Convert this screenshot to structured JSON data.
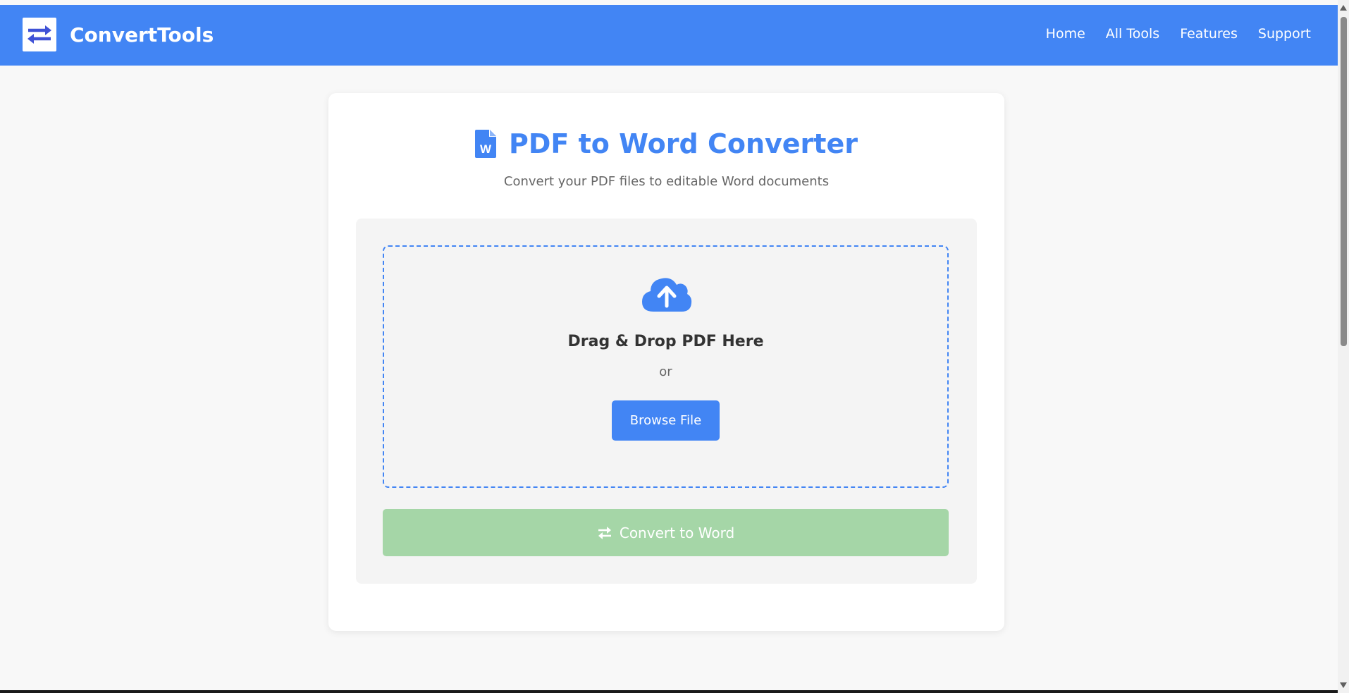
{
  "header": {
    "logo_icon": "exchange-arrows-icon",
    "brand": "ConvertTools",
    "nav": [
      "Home",
      "All Tools",
      "Features",
      "Support"
    ]
  },
  "converter": {
    "title_icon": "word-file-icon",
    "title": "PDF to Word Converter",
    "subtitle": "Convert your PDF files to editable Word documents",
    "dropzone": {
      "icon": "cloud-upload-icon",
      "title": "Drag & Drop PDF Here",
      "or": "or",
      "browse_label": "Browse File"
    },
    "convert_icon": "exchange-arrows-icon",
    "convert_label": "Convert to Word",
    "convert_disabled": true
  },
  "colors": {
    "primary": "#4285f4",
    "convert_disabled": "#a5d6a7",
    "background": "#f8f8f8",
    "panel": "#f4f4f4"
  }
}
